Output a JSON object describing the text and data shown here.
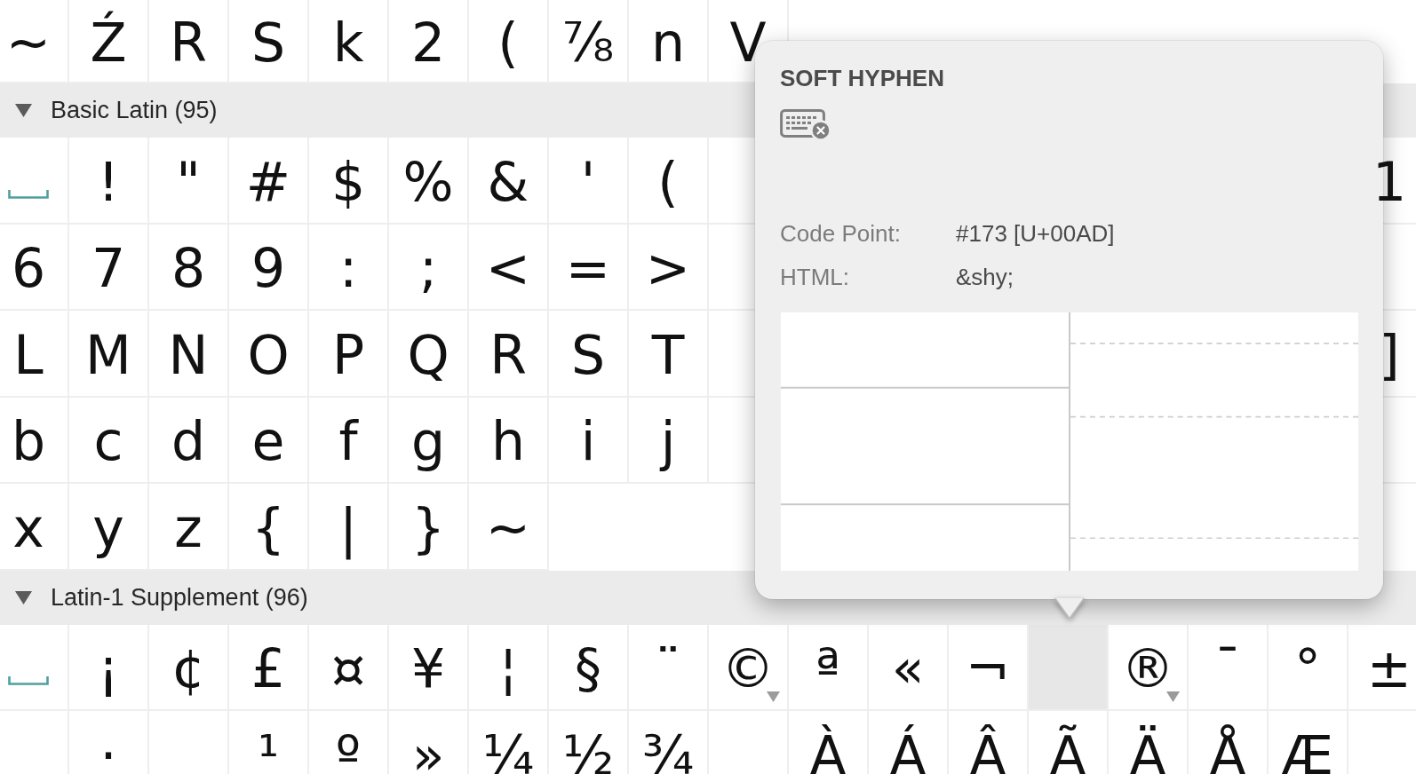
{
  "section_above": {
    "rows": [
      {
        "cells": [
          {
            "kind": "char",
            "text": "~",
            "selected": false,
            "variants": false
          },
          {
            "kind": "char",
            "text": "Ź",
            "selected": false,
            "variants": false
          },
          {
            "kind": "char",
            "text": "R",
            "selected": false,
            "variants": false
          },
          {
            "kind": "char",
            "text": "S",
            "selected": false,
            "variants": false
          },
          {
            "kind": "char",
            "text": "k",
            "selected": false,
            "variants": false
          },
          {
            "kind": "char",
            "text": "2",
            "selected": false,
            "variants": false
          },
          {
            "kind": "char",
            "text": "(",
            "selected": false,
            "variants": false
          },
          {
            "kind": "char",
            "text": "⅞",
            "selected": false,
            "variants": false
          },
          {
            "kind": "char",
            "text": "n",
            "selected": false,
            "variants": false
          },
          {
            "kind": "char",
            "text": "V",
            "selected": false,
            "variants": false
          }
        ]
      }
    ]
  },
  "sections": [
    {
      "title": "Basic Latin (95)",
      "expanded": true,
      "rows": [
        {
          "cells": [
            {
              "kind": "space",
              "selected": false,
              "variants": false
            },
            {
              "kind": "char",
              "text": "!",
              "selected": false,
              "variants": false
            },
            {
              "kind": "char",
              "text": "\"",
              "selected": false,
              "variants": false
            },
            {
              "kind": "char",
              "text": "#",
              "selected": false,
              "variants": false
            },
            {
              "kind": "char",
              "text": "$",
              "selected": false,
              "variants": false
            },
            {
              "kind": "char",
              "text": "%",
              "selected": false,
              "variants": false
            },
            {
              "kind": "char",
              "text": "&",
              "selected": false,
              "variants": false
            },
            {
              "kind": "char",
              "text": "'",
              "selected": false,
              "variants": false
            },
            {
              "kind": "char",
              "text": "(",
              "selected": false,
              "variants": false
            }
          ],
          "end_cells": [
            {
              "kind": "char",
              "text": "1",
              "selected": false,
              "variants": false
            }
          ]
        },
        {
          "cells": [
            {
              "kind": "char",
              "text": "6",
              "selected": false,
              "variants": false
            },
            {
              "kind": "char",
              "text": "7",
              "selected": false,
              "variants": false
            },
            {
              "kind": "char",
              "text": "8",
              "selected": false,
              "variants": false
            },
            {
              "kind": "char",
              "text": "9",
              "selected": false,
              "variants": false
            },
            {
              "kind": "char",
              "text": ":",
              "selected": false,
              "variants": false
            },
            {
              "kind": "char",
              "text": ";",
              "selected": false,
              "variants": false
            },
            {
              "kind": "char",
              "text": "<",
              "selected": false,
              "variants": false
            },
            {
              "kind": "char",
              "text": "=",
              "selected": false,
              "variants": false
            },
            {
              "kind": "char",
              "text": ">",
              "selected": false,
              "variants": false
            }
          ]
        },
        {
          "cells": [
            {
              "kind": "char",
              "text": "L",
              "selected": false,
              "variants": false
            },
            {
              "kind": "char",
              "text": "M",
              "selected": false,
              "variants": false
            },
            {
              "kind": "char",
              "text": "N",
              "selected": false,
              "variants": false
            },
            {
              "kind": "char",
              "text": "O",
              "selected": false,
              "variants": false
            },
            {
              "kind": "char",
              "text": "P",
              "selected": false,
              "variants": false
            },
            {
              "kind": "char",
              "text": "Q",
              "selected": false,
              "variants": false
            },
            {
              "kind": "char",
              "text": "R",
              "selected": false,
              "variants": false
            },
            {
              "kind": "char",
              "text": "S",
              "selected": false,
              "variants": false
            },
            {
              "kind": "char",
              "text": "T",
              "selected": false,
              "variants": false
            }
          ],
          "end_cells": [
            {
              "kind": "char",
              "text": "]",
              "selected": false,
              "variants": false
            }
          ]
        },
        {
          "cells": [
            {
              "kind": "char",
              "text": "b",
              "selected": false,
              "variants": false
            },
            {
              "kind": "char",
              "text": "c",
              "selected": false,
              "variants": false
            },
            {
              "kind": "char",
              "text": "d",
              "selected": false,
              "variants": false
            },
            {
              "kind": "char",
              "text": "e",
              "selected": false,
              "variants": false
            },
            {
              "kind": "char",
              "text": "f",
              "selected": false,
              "variants": false
            },
            {
              "kind": "char",
              "text": "g",
              "selected": false,
              "variants": false
            },
            {
              "kind": "char",
              "text": "h",
              "selected": false,
              "variants": false
            },
            {
              "kind": "char",
              "text": "i",
              "selected": false,
              "variants": false
            },
            {
              "kind": "char",
              "text": "j",
              "selected": false,
              "variants": false
            }
          ]
        },
        {
          "cells": [
            {
              "kind": "char",
              "text": "x",
              "selected": false,
              "variants": false
            },
            {
              "kind": "char",
              "text": "y",
              "selected": false,
              "variants": false
            },
            {
              "kind": "char",
              "text": "z",
              "selected": false,
              "variants": false
            },
            {
              "kind": "char",
              "text": "{",
              "selected": false,
              "variants": false
            },
            {
              "kind": "char",
              "text": "|",
              "selected": false,
              "variants": false
            },
            {
              "kind": "char",
              "text": "}",
              "selected": false,
              "variants": false
            },
            {
              "kind": "char",
              "text": "~",
              "selected": false,
              "variants": false
            }
          ]
        }
      ]
    },
    {
      "title": "Latin-1 Supplement (96)",
      "expanded": true,
      "rows": [
        {
          "cells": [
            {
              "kind": "space",
              "selected": false,
              "variants": false
            },
            {
              "kind": "char",
              "text": "¡",
              "selected": false,
              "variants": false
            },
            {
              "kind": "char",
              "text": "¢",
              "selected": false,
              "variants": false
            },
            {
              "kind": "char",
              "text": "£",
              "selected": false,
              "variants": false
            },
            {
              "kind": "char",
              "text": "¤",
              "selected": false,
              "variants": false
            },
            {
              "kind": "char",
              "text": "¥",
              "selected": false,
              "variants": false
            },
            {
              "kind": "char",
              "text": "¦",
              "selected": false,
              "variants": false
            },
            {
              "kind": "char",
              "text": "§",
              "selected": false,
              "variants": false
            },
            {
              "kind": "char",
              "text": "¨",
              "selected": false,
              "variants": false
            },
            {
              "kind": "char",
              "text": "©",
              "selected": false,
              "variants": true
            },
            {
              "kind": "char",
              "text": "ª",
              "selected": false,
              "variants": false
            },
            {
              "kind": "char",
              "text": "«",
              "selected": false,
              "variants": false
            },
            {
              "kind": "char",
              "text": "¬",
              "selected": false,
              "variants": false
            },
            {
              "kind": "blank",
              "selected": true,
              "variants": false
            },
            {
              "kind": "char",
              "text": "®",
              "selected": false,
              "variants": true
            },
            {
              "kind": "char",
              "text": "¯",
              "selected": false,
              "variants": false
            },
            {
              "kind": "char",
              "text": "°",
              "selected": false,
              "variants": false
            },
            {
              "kind": "char",
              "text": "±",
              "selected": false,
              "variants": false
            }
          ]
        },
        {
          "cells": [
            {
              "kind": "blank",
              "selected": false,
              "variants": false
            },
            {
              "kind": "char",
              "text": "·",
              "selected": false,
              "variants": false
            },
            {
              "kind": "blank",
              "selected": false,
              "variants": false
            },
            {
              "kind": "char",
              "text": "¹",
              "selected": false,
              "variants": false
            },
            {
              "kind": "char",
              "text": "º",
              "selected": false,
              "variants": false
            },
            {
              "kind": "char",
              "text": "»",
              "selected": false,
              "variants": false
            },
            {
              "kind": "char",
              "text": "¼",
              "selected": false,
              "variants": false
            },
            {
              "kind": "char",
              "text": "½",
              "selected": false,
              "variants": false
            },
            {
              "kind": "char",
              "text": "¾",
              "selected": false,
              "variants": false
            },
            {
              "kind": "blank",
              "selected": false,
              "variants": false
            },
            {
              "kind": "char",
              "text": "À",
              "selected": false,
              "variants": false
            },
            {
              "kind": "char",
              "text": "Á",
              "selected": false,
              "variants": false
            },
            {
              "kind": "char",
              "text": "Â",
              "selected": false,
              "variants": false
            },
            {
              "kind": "char",
              "text": "Ã",
              "selected": false,
              "variants": false
            },
            {
              "kind": "char",
              "text": "Ä",
              "selected": false,
              "variants": false
            },
            {
              "kind": "char",
              "text": "Å",
              "selected": false,
              "variants": false
            },
            {
              "kind": "char",
              "text": "Æ",
              "selected": false,
              "variants": false
            },
            {
              "kind": "blank",
              "selected": false,
              "variants": false
            }
          ]
        }
      ]
    }
  ],
  "popover": {
    "title": "SOFT HYPHEN",
    "fields": [
      {
        "label": "Code Point:",
        "value": "#173 [U+00AD]"
      },
      {
        "label": "HTML:",
        "value": "&shy;"
      }
    ]
  }
}
